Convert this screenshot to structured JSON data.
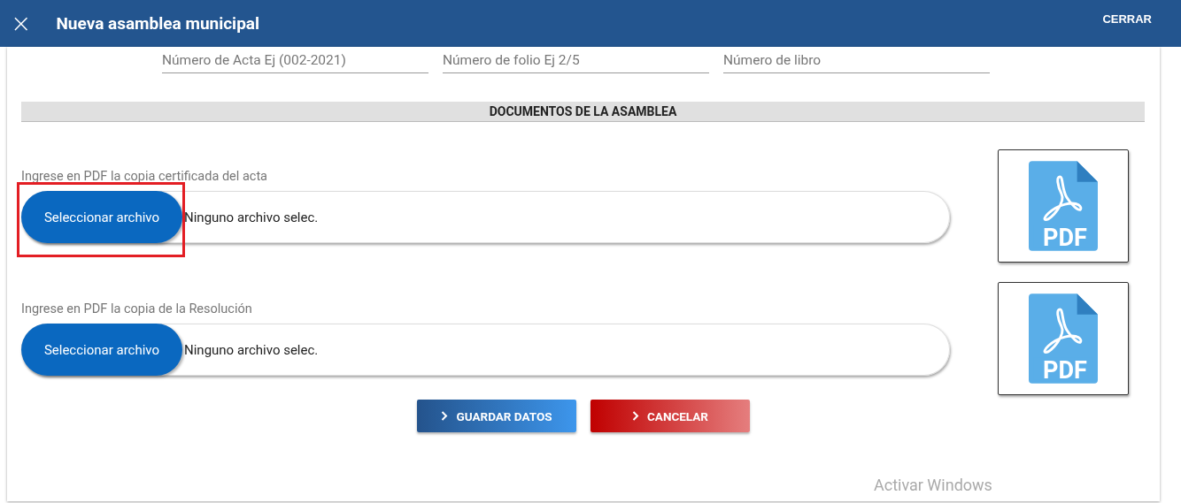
{
  "header": {
    "close_icon": "×",
    "title": "Nueva asamblea municipal",
    "action": "CERRAR"
  },
  "fields": [
    {
      "placeholder": "Número de Acta Ej (002-2021)"
    },
    {
      "placeholder": "Número de folio Ej 2/5"
    },
    {
      "placeholder": "Número de libro"
    }
  ],
  "section": {
    "title": "DOCUMENTOS DE LA ASAMBLEA"
  },
  "uploads": [
    {
      "label": "Ingrese en PDF la copia certificada del acta",
      "button": "Seleccionar archivo",
      "value": "Ninguno archivo selec.",
      "highlighted": true,
      "preview_label": "PDF"
    },
    {
      "label": "Ingrese en PDF la copia de la Resolución",
      "button": "Seleccionar archivo",
      "value": "Ninguno archivo selec.",
      "highlighted": false,
      "preview_label": "PDF"
    }
  ],
  "buttons": [
    {
      "kind": "primary",
      "label": "GUARDAR DATOS"
    },
    {
      "kind": "danger",
      "label": "CANCELAR"
    }
  ],
  "os_notice": "Activar Windows"
}
